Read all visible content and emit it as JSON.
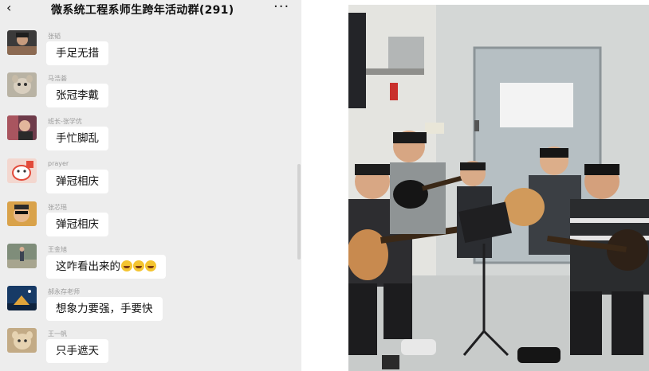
{
  "header": {
    "back_icon": "‹",
    "title": "微系统工程系师生跨年活动群(291)",
    "more_icon": "···"
  },
  "messages": [
    {
      "sender": "张韬",
      "text": "手足无措"
    },
    {
      "sender": "马浩荟",
      "text": "张冠李戴"
    },
    {
      "sender": "班长-张学优",
      "text": "手忙脚乱"
    },
    {
      "sender": "prayer",
      "text": "弹冠相庆"
    },
    {
      "sender": "张芯瑶",
      "text": "弹冠相庆"
    },
    {
      "sender": "王金旭",
      "text": "这咋看出来的"
    },
    {
      "sender": "郝永存老师",
      "text": "想象力要强，手要快"
    },
    {
      "sender": "王一帆",
      "text": "只手遮天"
    }
  ],
  "colors": {
    "chat_background": "#ededed",
    "bubble": "#ffffff",
    "sender_text": "#9a9a9a"
  }
}
